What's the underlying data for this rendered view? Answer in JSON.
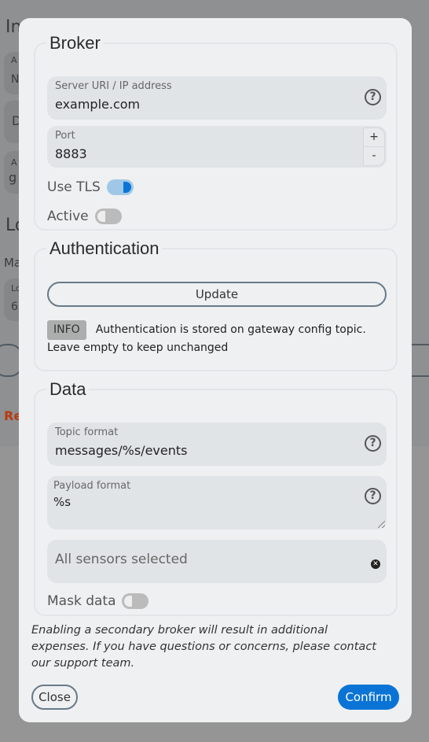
{
  "background_fragments": [
    "In",
    "A",
    "N",
    "D",
    "A",
    "g",
    "Lo",
    "Ma",
    "Lo",
    "6",
    "Re"
  ],
  "broker": {
    "legend": "Broker",
    "server": {
      "label": "Server URI / IP address",
      "value": "example.com",
      "help_icon": "question-circle-icon"
    },
    "port": {
      "label": "Port",
      "value": "8883",
      "increment": "+",
      "decrement": "-"
    },
    "use_tls": {
      "label": "Use TLS",
      "on": true
    },
    "active": {
      "label": "Active",
      "on": false
    }
  },
  "auth": {
    "legend": "Authentication",
    "update_label": "Update",
    "badge": "INFO",
    "info_text": "Authentication is stored on gateway config topic. Leave empty to keep unchanged"
  },
  "data": {
    "legend": "Data",
    "topic": {
      "label": "Topic format",
      "value": "messages/%s/events"
    },
    "payload": {
      "label": "Payload format",
      "value": "%s"
    },
    "sensors": {
      "placeholder": "All sensors selected"
    },
    "mask": {
      "label": "Mask data",
      "on": false
    }
  },
  "note": "Enabling a secondary broker will result in additional expenses. If you have questions or concerns, please contact our support team.",
  "footer": {
    "close": "Close",
    "confirm": "Confirm"
  },
  "colors": {
    "accent": "#0a74d6",
    "overlay": "#8f9091",
    "modal": "#eff0f2"
  }
}
